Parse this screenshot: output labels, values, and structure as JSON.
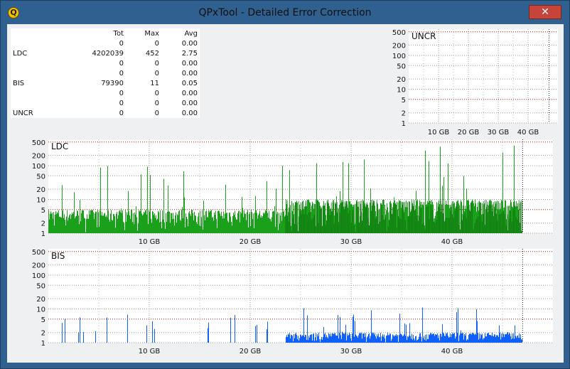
{
  "window": {
    "title": "QPxTool - Detailed Error Correction",
    "app_icon": "Q",
    "close_glyph": "✕"
  },
  "stats": {
    "headers": [
      "Tot",
      "Max",
      "Avg"
    ],
    "rows": [
      {
        "label": "",
        "tot": "0",
        "max": "0",
        "avg": "0.00"
      },
      {
        "label": "LDC",
        "tot": "4202039",
        "max": "452",
        "avg": "2.75"
      },
      {
        "label": "",
        "tot": "0",
        "max": "0",
        "avg": "0.00"
      },
      {
        "label": "",
        "tot": "0",
        "max": "0",
        "avg": "0.00"
      },
      {
        "label": "BIS",
        "tot": "79390",
        "max": "11",
        "avg": "0.05"
      },
      {
        "label": "",
        "tot": "0",
        "max": "0",
        "avg": "0.00"
      },
      {
        "label": "",
        "tot": "0",
        "max": "0",
        "avg": "0.00"
      },
      {
        "label": "UNCR",
        "tot": "0",
        "max": "0",
        "avg": "0.00"
      }
    ]
  },
  "chart_data": [
    {
      "type": "bar",
      "title": "UNCR",
      "scale": "log",
      "y_ticks": [
        1,
        2,
        5,
        10,
        20,
        50,
        100,
        200,
        500
      ],
      "x_ticks": [
        "10 GB",
        "20 GB",
        "30 GB",
        "40 GB"
      ],
      "x_max_gb": 50,
      "data_end_gb": 47,
      "threshold": 5,
      "values": "all zero",
      "color": "#1aa01a"
    },
    {
      "type": "bar",
      "title": "LDC",
      "scale": "log",
      "y_ticks": [
        1,
        2,
        5,
        10,
        20,
        50,
        100,
        200,
        500
      ],
      "x_ticks": [
        "10 GB",
        "20 GB",
        "30 GB",
        "40 GB"
      ],
      "x_max_gb": 50,
      "data_end_gb": 47,
      "threshold": 5,
      "max": 452,
      "segments": [
        {
          "from_gb": 0,
          "to_gb": 23.5,
          "typical": 5,
          "peak": 100
        },
        {
          "from_gb": 23.5,
          "to_gb": 47,
          "typical": 10,
          "peak": 400
        }
      ],
      "color": "#1aa01a",
      "dark_color": "#0a5a0a"
    },
    {
      "type": "bar",
      "title": "BIS",
      "scale": "log",
      "y_ticks": [
        1,
        2,
        5,
        10,
        20,
        50,
        100,
        200,
        500
      ],
      "x_ticks": [
        "10 GB",
        "20 GB",
        "30 GB",
        "40 GB"
      ],
      "x_max_gb": 50,
      "data_end_gb": 47,
      "threshold": 5,
      "max": 11,
      "segments": [
        {
          "from_gb": 0,
          "to_gb": 23.5,
          "typical": 1,
          "peak": 7
        },
        {
          "from_gb": 23.5,
          "to_gb": 47,
          "typical": 2,
          "peak": 11
        }
      ],
      "color": "#1060ff"
    }
  ]
}
